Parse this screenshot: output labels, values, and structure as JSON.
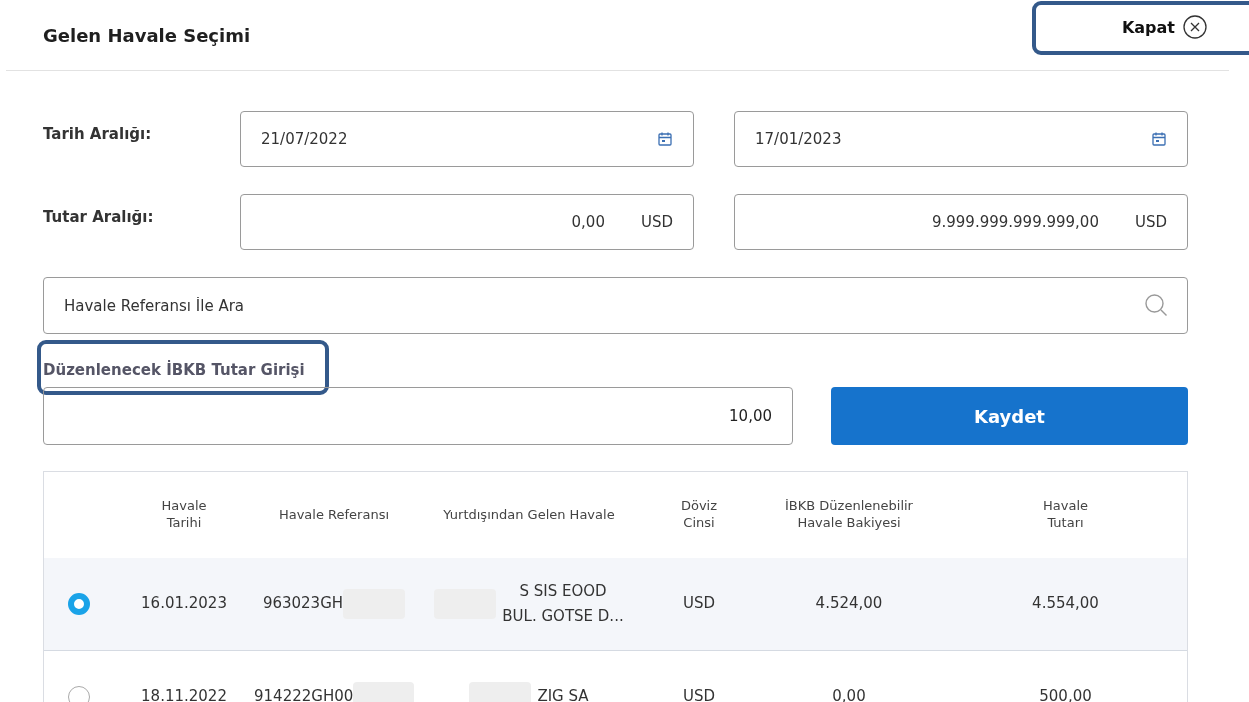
{
  "header": {
    "title": "Gelen Havale Seçimi",
    "close_label": "Kapat"
  },
  "date_range": {
    "label": "Tarih Aralığı:",
    "from": "21/07/2022",
    "to": "17/01/2023"
  },
  "amount_range": {
    "label": "Tutar Aralığı:",
    "from": "0,00",
    "to": "9.999.999.999.999,00",
    "currency_from": "USD",
    "currency_to": "USD"
  },
  "search": {
    "placeholder": "Havale Referansı İle Ara"
  },
  "ibkb_amount": {
    "label": "Düzenlenecek İBKB Tutar Girişi",
    "value": "10,00",
    "save_label": "Kaydet"
  },
  "table": {
    "columns": [
      "Havale\nTarihi",
      "Havale Referansı",
      "Yurtdışından Gelen Havale",
      "Döviz\nCinsi",
      "İBKB Düzenlenebilir\nHavale Bakiyesi",
      "Havale\nTutarı"
    ],
    "rows": [
      {
        "selected": true,
        "date": "16.01.2023",
        "reference": "963023GH",
        "sender": [
          "S SIS EOOD",
          "BUL. GOTSE D..."
        ],
        "currency": "USD",
        "balance": "4.524,00",
        "amount": "4.554,00"
      },
      {
        "selected": false,
        "date": "18.11.2022",
        "reference": "914222GH00",
        "sender": [
          "ZIG SA"
        ],
        "currency": "USD",
        "balance": "0,00",
        "amount": "500,00"
      }
    ]
  }
}
